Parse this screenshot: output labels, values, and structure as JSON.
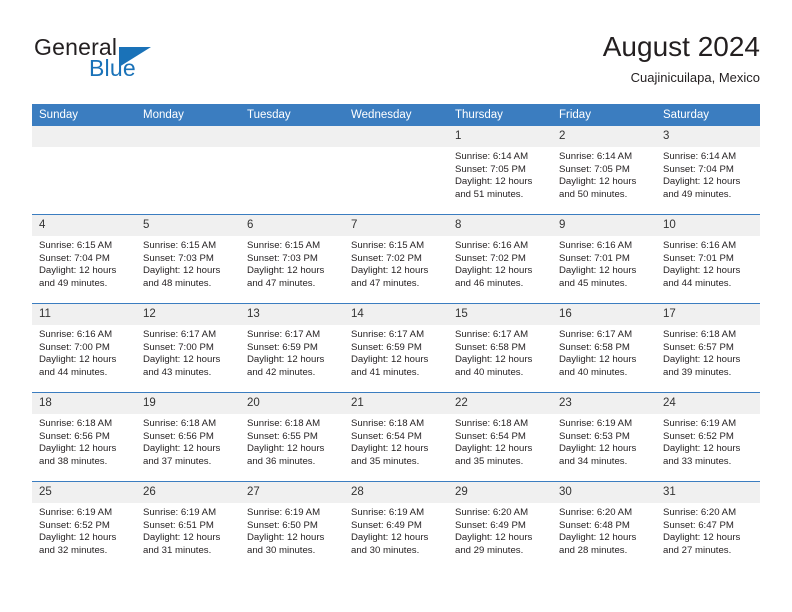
{
  "brand": {
    "word1": "General",
    "word2": "Blue",
    "accent_color": "#1a72b8"
  },
  "header": {
    "title": "August 2024",
    "subtitle": "Cuajinicuilapa, Mexico",
    "header_bg": "#3b7dc0",
    "daynum_bg": "#f0f0f0"
  },
  "weekday_headers": [
    "Sunday",
    "Monday",
    "Tuesday",
    "Wednesday",
    "Thursday",
    "Friday",
    "Saturday"
  ],
  "labels": {
    "sunrise_prefix": "Sunrise:",
    "sunset_prefix": "Sunset:",
    "daylight_prefix": "Daylight:"
  },
  "weeks": [
    [
      {
        "day": "",
        "empty": true
      },
      {
        "day": "",
        "empty": true
      },
      {
        "day": "",
        "empty": true
      },
      {
        "day": "",
        "empty": true
      },
      {
        "day": "1",
        "sunrise": "Sunrise: 6:14 AM",
        "sunset": "Sunset: 7:05 PM",
        "daylight": "Daylight: 12 hours and 51 minutes."
      },
      {
        "day": "2",
        "sunrise": "Sunrise: 6:14 AM",
        "sunset": "Sunset: 7:05 PM",
        "daylight": "Daylight: 12 hours and 50 minutes."
      },
      {
        "day": "3",
        "sunrise": "Sunrise: 6:14 AM",
        "sunset": "Sunset: 7:04 PM",
        "daylight": "Daylight: 12 hours and 49 minutes."
      }
    ],
    [
      {
        "day": "4",
        "sunrise": "Sunrise: 6:15 AM",
        "sunset": "Sunset: 7:04 PM",
        "daylight": "Daylight: 12 hours and 49 minutes."
      },
      {
        "day": "5",
        "sunrise": "Sunrise: 6:15 AM",
        "sunset": "Sunset: 7:03 PM",
        "daylight": "Daylight: 12 hours and 48 minutes."
      },
      {
        "day": "6",
        "sunrise": "Sunrise: 6:15 AM",
        "sunset": "Sunset: 7:03 PM",
        "daylight": "Daylight: 12 hours and 47 minutes."
      },
      {
        "day": "7",
        "sunrise": "Sunrise: 6:15 AM",
        "sunset": "Sunset: 7:02 PM",
        "daylight": "Daylight: 12 hours and 47 minutes."
      },
      {
        "day": "8",
        "sunrise": "Sunrise: 6:16 AM",
        "sunset": "Sunset: 7:02 PM",
        "daylight": "Daylight: 12 hours and 46 minutes."
      },
      {
        "day": "9",
        "sunrise": "Sunrise: 6:16 AM",
        "sunset": "Sunset: 7:01 PM",
        "daylight": "Daylight: 12 hours and 45 minutes."
      },
      {
        "day": "10",
        "sunrise": "Sunrise: 6:16 AM",
        "sunset": "Sunset: 7:01 PM",
        "daylight": "Daylight: 12 hours and 44 minutes."
      }
    ],
    [
      {
        "day": "11",
        "sunrise": "Sunrise: 6:16 AM",
        "sunset": "Sunset: 7:00 PM",
        "daylight": "Daylight: 12 hours and 44 minutes."
      },
      {
        "day": "12",
        "sunrise": "Sunrise: 6:17 AM",
        "sunset": "Sunset: 7:00 PM",
        "daylight": "Daylight: 12 hours and 43 minutes."
      },
      {
        "day": "13",
        "sunrise": "Sunrise: 6:17 AM",
        "sunset": "Sunset: 6:59 PM",
        "daylight": "Daylight: 12 hours and 42 minutes."
      },
      {
        "day": "14",
        "sunrise": "Sunrise: 6:17 AM",
        "sunset": "Sunset: 6:59 PM",
        "daylight": "Daylight: 12 hours and 41 minutes."
      },
      {
        "day": "15",
        "sunrise": "Sunrise: 6:17 AM",
        "sunset": "Sunset: 6:58 PM",
        "daylight": "Daylight: 12 hours and 40 minutes."
      },
      {
        "day": "16",
        "sunrise": "Sunrise: 6:17 AM",
        "sunset": "Sunset: 6:58 PM",
        "daylight": "Daylight: 12 hours and 40 minutes."
      },
      {
        "day": "17",
        "sunrise": "Sunrise: 6:18 AM",
        "sunset": "Sunset: 6:57 PM",
        "daylight": "Daylight: 12 hours and 39 minutes."
      }
    ],
    [
      {
        "day": "18",
        "sunrise": "Sunrise: 6:18 AM",
        "sunset": "Sunset: 6:56 PM",
        "daylight": "Daylight: 12 hours and 38 minutes."
      },
      {
        "day": "19",
        "sunrise": "Sunrise: 6:18 AM",
        "sunset": "Sunset: 6:56 PM",
        "daylight": "Daylight: 12 hours and 37 minutes."
      },
      {
        "day": "20",
        "sunrise": "Sunrise: 6:18 AM",
        "sunset": "Sunset: 6:55 PM",
        "daylight": "Daylight: 12 hours and 36 minutes."
      },
      {
        "day": "21",
        "sunrise": "Sunrise: 6:18 AM",
        "sunset": "Sunset: 6:54 PM",
        "daylight": "Daylight: 12 hours and 35 minutes."
      },
      {
        "day": "22",
        "sunrise": "Sunrise: 6:18 AM",
        "sunset": "Sunset: 6:54 PM",
        "daylight": "Daylight: 12 hours and 35 minutes."
      },
      {
        "day": "23",
        "sunrise": "Sunrise: 6:19 AM",
        "sunset": "Sunset: 6:53 PM",
        "daylight": "Daylight: 12 hours and 34 minutes."
      },
      {
        "day": "24",
        "sunrise": "Sunrise: 6:19 AM",
        "sunset": "Sunset: 6:52 PM",
        "daylight": "Daylight: 12 hours and 33 minutes."
      }
    ],
    [
      {
        "day": "25",
        "sunrise": "Sunrise: 6:19 AM",
        "sunset": "Sunset: 6:52 PM",
        "daylight": "Daylight: 12 hours and 32 minutes."
      },
      {
        "day": "26",
        "sunrise": "Sunrise: 6:19 AM",
        "sunset": "Sunset: 6:51 PM",
        "daylight": "Daylight: 12 hours and 31 minutes."
      },
      {
        "day": "27",
        "sunrise": "Sunrise: 6:19 AM",
        "sunset": "Sunset: 6:50 PM",
        "daylight": "Daylight: 12 hours and 30 minutes."
      },
      {
        "day": "28",
        "sunrise": "Sunrise: 6:19 AM",
        "sunset": "Sunset: 6:49 PM",
        "daylight": "Daylight: 12 hours and 30 minutes."
      },
      {
        "day": "29",
        "sunrise": "Sunrise: 6:20 AM",
        "sunset": "Sunset: 6:49 PM",
        "daylight": "Daylight: 12 hours and 29 minutes."
      },
      {
        "day": "30",
        "sunrise": "Sunrise: 6:20 AM",
        "sunset": "Sunset: 6:48 PM",
        "daylight": "Daylight: 12 hours and 28 minutes."
      },
      {
        "day": "31",
        "sunrise": "Sunrise: 6:20 AM",
        "sunset": "Sunset: 6:47 PM",
        "daylight": "Daylight: 12 hours and 27 minutes."
      }
    ]
  ]
}
